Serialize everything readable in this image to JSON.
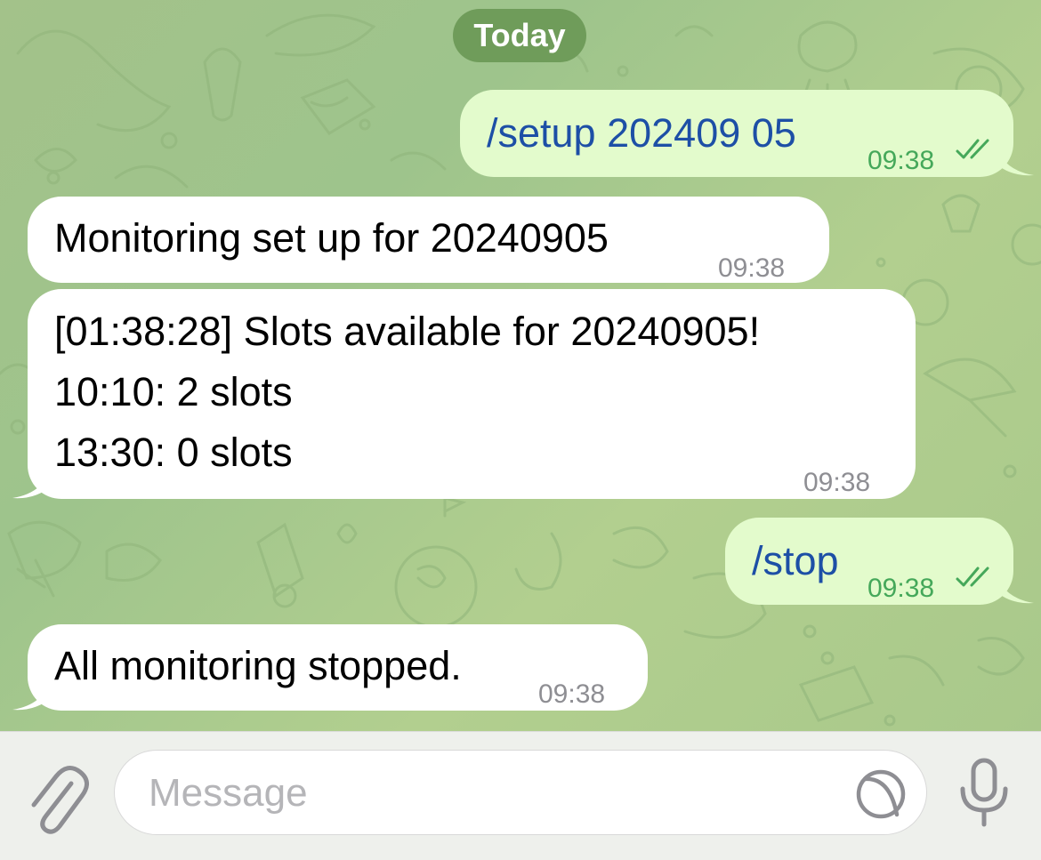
{
  "date_separator": "Today",
  "messages": [
    {
      "direction": "outgoing",
      "text": "/setup 202409 05",
      "time": "09:38",
      "status": "read"
    },
    {
      "direction": "incoming",
      "text": "Monitoring set up for 20240905",
      "time": "09:38"
    },
    {
      "direction": "incoming",
      "lines": [
        "[01:38:28] Slots available for 20240905!",
        "10:10: 2 slots",
        "13:30: 0 slots"
      ],
      "time": "09:38"
    },
    {
      "direction": "outgoing",
      "text": "/stop",
      "time": "09:38",
      "status": "read"
    },
    {
      "direction": "incoming",
      "text": "All monitoring stopped.",
      "time": "09:38"
    }
  ],
  "composer": {
    "placeholder": "Message",
    "attach_icon": "paperclip-icon",
    "sticker_icon": "sticker-icon",
    "mic_icon": "microphone-icon"
  },
  "colors": {
    "outgoing_bubble": "#e3fbcc",
    "outgoing_text": "#1d4fa6",
    "outgoing_meta": "#45a85a",
    "incoming_bubble": "#ffffff",
    "date_pill": "#6f9c5a"
  }
}
